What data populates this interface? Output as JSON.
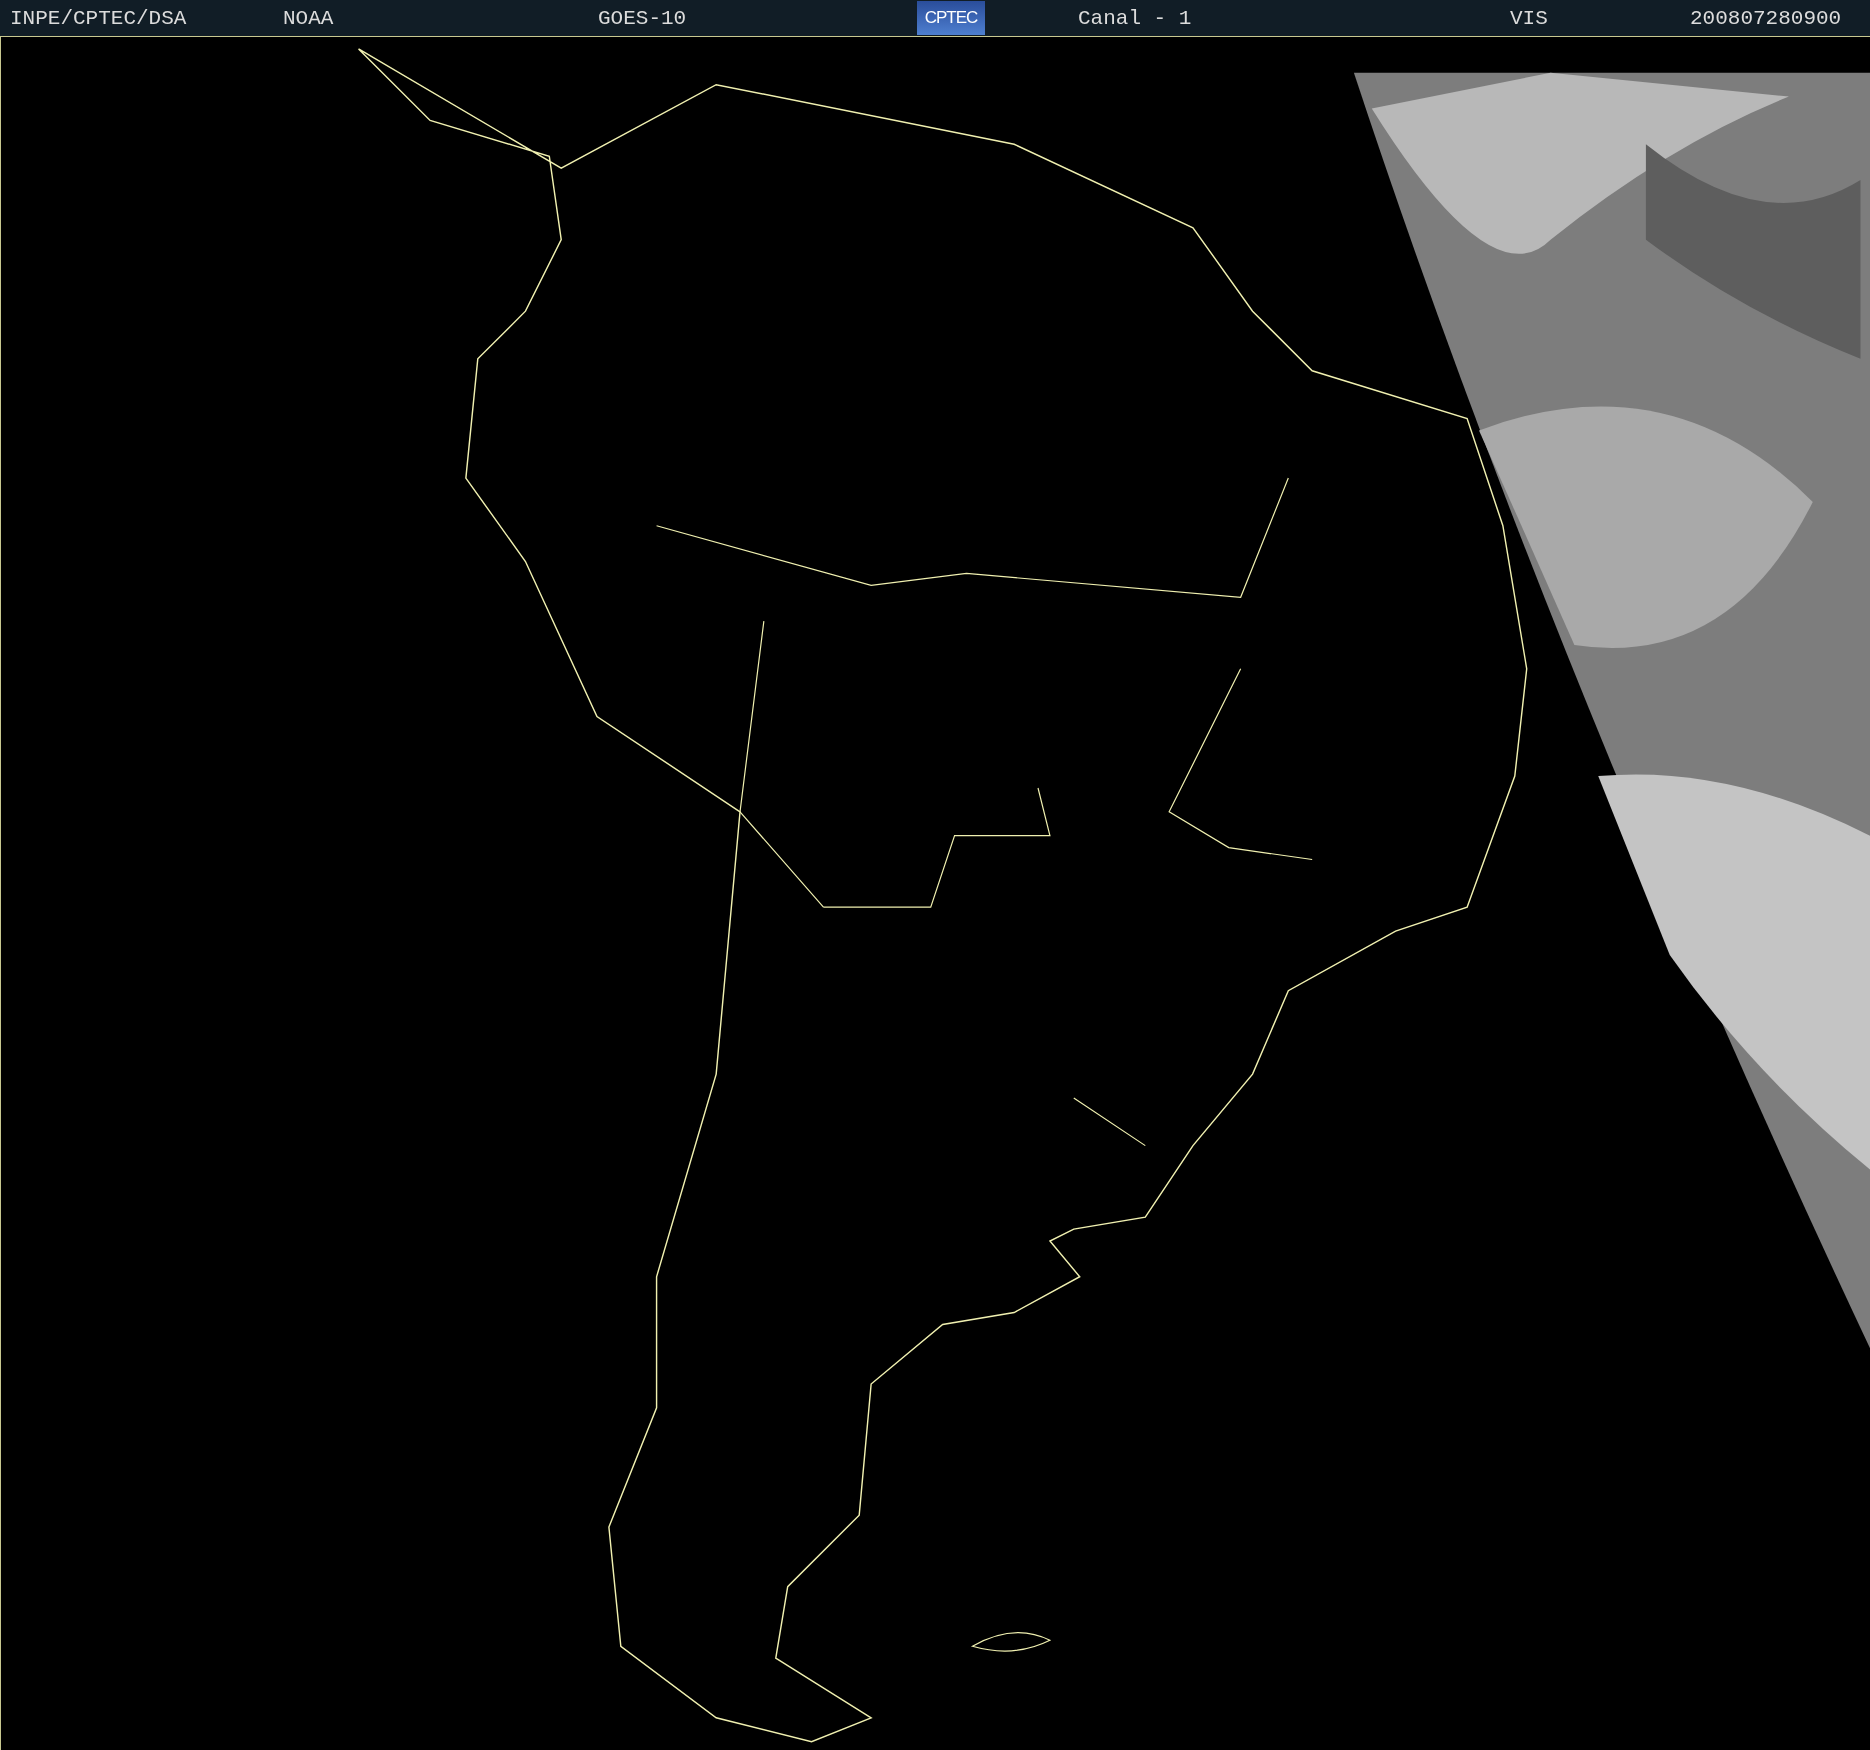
{
  "header": {
    "labels": [
      {
        "text": "INPE/CPTEC/DSA"
      },
      {
        "text": "NOAA"
      },
      {
        "text": "GOES-10"
      },
      {
        "kind": "logo",
        "text": "CPTEC"
      },
      {
        "text": "Canal - 1"
      },
      {
        "text": "VIS"
      },
      {
        "text": "200807280900"
      }
    ]
  }
}
